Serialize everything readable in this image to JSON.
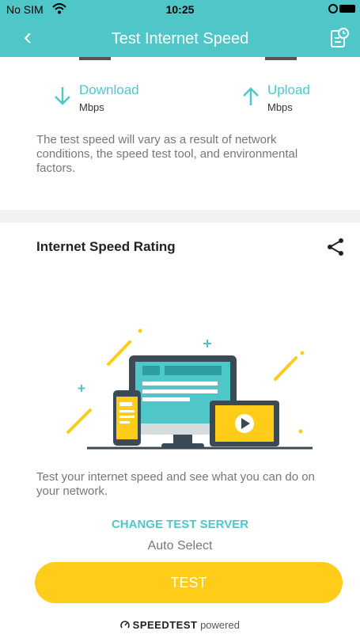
{
  "status_bar": {
    "carrier": "No SIM",
    "time": "10:25"
  },
  "header": {
    "title": "Test Internet Speed"
  },
  "download": {
    "label": "Download",
    "unit": "Mbps"
  },
  "upload": {
    "label": "Upload",
    "unit": "Mbps"
  },
  "note": "The test speed will vary as a result of network conditions, the speed test tool, and environmental factors.",
  "rating": {
    "title": "Internet Speed Rating",
    "description": "Test your internet speed and see what you can do on your network."
  },
  "server": {
    "change_label": "CHANGE TEST SERVER",
    "value": "Auto Select"
  },
  "test_button": {
    "label": "TEST"
  },
  "powered": {
    "brand": "SPEEDTEST",
    "suffix": "powered"
  },
  "colors": {
    "accent": "#4fc7c9",
    "button": "#ffcc1a",
    "illustration_yellow": "#ffcc1a",
    "screen_dark": "#3c4a56"
  },
  "icons": [
    "back-chevron-icon",
    "history-icon",
    "download-arrow-icon",
    "upload-arrow-icon",
    "share-icon",
    "speedtest-logo-icon",
    "wifi-icon",
    "battery-icon"
  ]
}
